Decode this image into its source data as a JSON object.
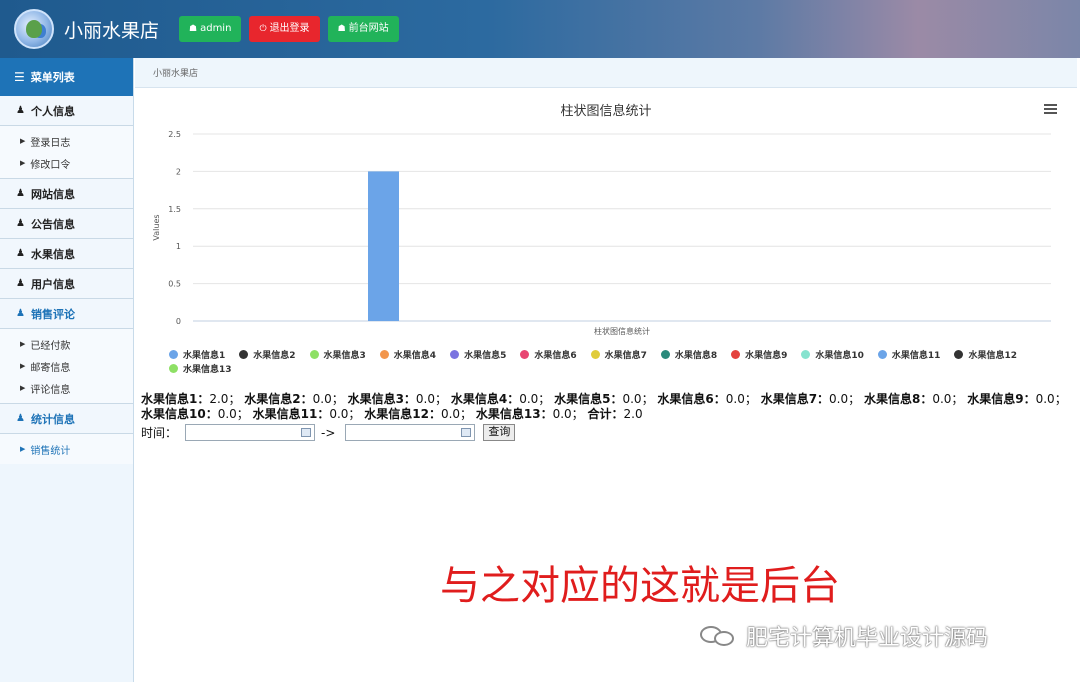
{
  "header": {
    "brand": "小丽水果店",
    "buttons": [
      {
        "label": "admin",
        "icon": "home-icon"
      },
      {
        "label": "退出登录",
        "icon": "power-icon"
      },
      {
        "label": "前台网站",
        "icon": "home-icon"
      }
    ]
  },
  "sidebar": {
    "title": "菜单列表",
    "sections": [
      {
        "label": "个人信息",
        "items": [
          "登录日志",
          "修改口令"
        ]
      },
      {
        "label": "网站信息"
      },
      {
        "label": "公告信息"
      },
      {
        "label": "水果信息"
      },
      {
        "label": "用户信息"
      },
      {
        "label": "销售评论",
        "items": [
          "已经付款",
          "邮寄信息",
          "评论信息"
        ]
      },
      {
        "label": "统计信息",
        "items": [
          "销售统计"
        ]
      }
    ]
  },
  "breadcrumb": "小丽水果店",
  "chart_data": {
    "type": "bar",
    "title": "柱状图信息统计",
    "xlabel": "柱状图信息统计",
    "ylabel": "Values",
    "ylim": [
      0,
      2.5
    ],
    "yticks": [
      "0",
      "0.5",
      "1",
      "1.5",
      "2",
      "2.5"
    ],
    "grid": true,
    "legend_position": "bottom-left",
    "series": [
      {
        "name": "水果信息1",
        "value": 2.0,
        "color": "#6ba4e8"
      },
      {
        "name": "水果信息2",
        "value": 0.0,
        "color": "#333333"
      },
      {
        "name": "水果信息3",
        "value": 0.0,
        "color": "#8ee065"
      },
      {
        "name": "水果信息4",
        "value": 0.0,
        "color": "#f2964d"
      },
      {
        "name": "水果信息5",
        "value": 0.0,
        "color": "#7b74e0"
      },
      {
        "name": "水果信息6",
        "value": 0.0,
        "color": "#e84672"
      },
      {
        "name": "水果信息7",
        "value": 0.0,
        "color": "#e0cc3c"
      },
      {
        "name": "水果信息8",
        "value": 0.0,
        "color": "#2b8a7c"
      },
      {
        "name": "水果信息9",
        "value": 0.0,
        "color": "#e4433e"
      },
      {
        "name": "水果信息10",
        "value": 0.0,
        "color": "#86e3cf"
      },
      {
        "name": "水果信息11",
        "value": 0.0,
        "color": "#6ba4e8"
      },
      {
        "name": "水果信息12",
        "value": 0.0,
        "color": "#333333"
      },
      {
        "name": "水果信息13",
        "value": 0.0,
        "color": "#8ee065"
      }
    ]
  },
  "summary": {
    "items": [
      {
        "name": "水果信息1",
        "value": "2.0"
      },
      {
        "name": "水果信息2",
        "value": "0.0"
      },
      {
        "name": "水果信息3",
        "value": "0.0"
      },
      {
        "name": "水果信息4",
        "value": "0.0"
      },
      {
        "name": "水果信息5",
        "value": "0.0"
      },
      {
        "name": "水果信息6",
        "value": "0.0"
      },
      {
        "name": "水果信息7",
        "value": "0.0"
      },
      {
        "name": "水果信息8",
        "value": "0.0"
      },
      {
        "name": "水果信息9",
        "value": "0.0"
      },
      {
        "name": "水果信息10",
        "value": "0.0"
      },
      {
        "name": "水果信息11",
        "value": "0.0"
      },
      {
        "name": "水果信息12",
        "value": "0.0"
      },
      {
        "name": "水果信息13",
        "value": "0.0"
      }
    ],
    "total_label": "合计",
    "total_value": "2.0"
  },
  "filter": {
    "label": "时间：",
    "arrow": "->",
    "start_value": "",
    "end_value": "",
    "button_label": "查询"
  },
  "overlay": {
    "caption": "与之对应的这就是后台",
    "watermark": "肥宅计算机毕业设计源码"
  }
}
